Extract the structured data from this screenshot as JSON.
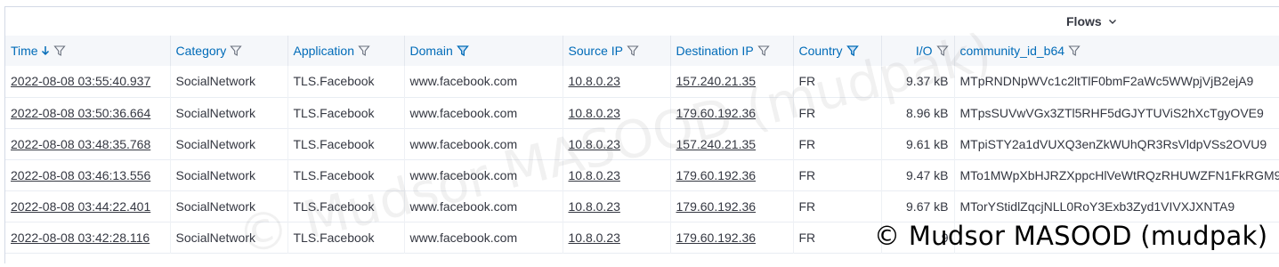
{
  "toolbar": {
    "flows_label": "Flows"
  },
  "columns": [
    {
      "label": "Time",
      "sorted": true,
      "filter_active": false
    },
    {
      "label": "Category",
      "sorted": false,
      "filter_active": false
    },
    {
      "label": "Application",
      "sorted": false,
      "filter_active": false
    },
    {
      "label": "Domain",
      "sorted": false,
      "filter_active": true
    },
    {
      "label": "Source IP",
      "sorted": false,
      "filter_active": false
    },
    {
      "label": "Destination IP",
      "sorted": false,
      "filter_active": false
    },
    {
      "label": "Country",
      "sorted": false,
      "filter_active": true
    },
    {
      "label": "I/O",
      "sorted": false,
      "filter_active": false
    },
    {
      "label": "community_id_b64",
      "sorted": false,
      "filter_active": false
    }
  ],
  "rows": [
    {
      "time": "2022-08-08 03:55:40.937",
      "category": "SocialNetwork",
      "application": "TLS.Facebook",
      "domain": "www.facebook.com",
      "source_ip": "10.8.0.23",
      "destination_ip": "157.240.21.35",
      "country": "FR",
      "io": "9.37 kB",
      "community_id": "MTpRNDNpWVc1c2ltTlF0bmF2aWc5WWpjVjB2ejA9"
    },
    {
      "time": "2022-08-08 03:50:36.664",
      "category": "SocialNetwork",
      "application": "TLS.Facebook",
      "domain": "www.facebook.com",
      "source_ip": "10.8.0.23",
      "destination_ip": "179.60.192.36",
      "country": "FR",
      "io": "8.96 kB",
      "community_id": "MTpsSUVwVGx3ZTl5RHF5dGJYTUViS2hXcTgyOVE9"
    },
    {
      "time": "2022-08-08 03:48:35.768",
      "category": "SocialNetwork",
      "application": "TLS.Facebook",
      "domain": "www.facebook.com",
      "source_ip": "10.8.0.23",
      "destination_ip": "157.240.21.35",
      "country": "FR",
      "io": "9.61 kB",
      "community_id": "MTpiSTY2a1dVUXQ3enZkWUhQR3RsVldpVSs2OVU9"
    },
    {
      "time": "2022-08-08 03:46:13.556",
      "category": "SocialNetwork",
      "application": "TLS.Facebook",
      "domain": "www.facebook.com",
      "source_ip": "10.8.0.23",
      "destination_ip": "179.60.192.36",
      "country": "FR",
      "io": "9.47 kB",
      "community_id": "MTo1MWpXbHJRZXppcHlVeWtRQzRHUWZFN1FkRGM9"
    },
    {
      "time": "2022-08-08 03:44:22.401",
      "category": "SocialNetwork",
      "application": "TLS.Facebook",
      "domain": "www.facebook.com",
      "source_ip": "10.8.0.23",
      "destination_ip": "179.60.192.36",
      "country": "FR",
      "io": "9.67 kB",
      "community_id": "MTorYStidlZqcjNLL0RoY3Exb3Zyd1VIVXJXNTA9"
    },
    {
      "time": "2022-08-08 03:42:28.116",
      "category": "SocialNetwork",
      "application": "TLS.Facebook",
      "domain": "www.facebook.com",
      "source_ip": "10.8.0.23",
      "destination_ip": "179.60.192.36",
      "country": "FR",
      "io": "9",
      "community_id": ""
    }
  ],
  "watermark": "© Mudsor MASOOD (mudpak)",
  "colors": {
    "header_text": "#006bb8",
    "header_bg": "#f5f7fa",
    "body_text": "#343741",
    "border": "#d3dae6"
  }
}
